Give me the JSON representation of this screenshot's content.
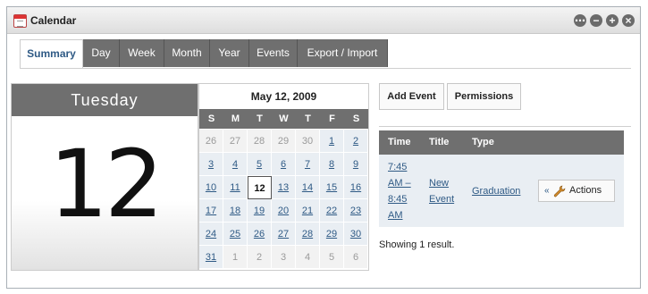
{
  "portlet": {
    "title": "Calendar",
    "icon": "calendar-icon"
  },
  "window_buttons": [
    "options-icon",
    "minimize-icon",
    "maximize-icon",
    "close-icon"
  ],
  "tabs": [
    {
      "label": "Summary",
      "active": true
    },
    {
      "label": "Day"
    },
    {
      "label": "Week"
    },
    {
      "label": "Month"
    },
    {
      "label": "Year"
    },
    {
      "label": "Events"
    },
    {
      "label": "Export / Import"
    }
  ],
  "day": {
    "name": "Tuesday",
    "number": "12"
  },
  "minical": {
    "month_label": "May 12, 2009",
    "dow": [
      "S",
      "M",
      "T",
      "W",
      "T",
      "F",
      "S"
    ],
    "weeks": [
      [
        {
          "d": "26",
          "o": true
        },
        {
          "d": "27",
          "o": true
        },
        {
          "d": "28",
          "o": true
        },
        {
          "d": "29",
          "o": true
        },
        {
          "d": "30",
          "o": true
        },
        {
          "d": "1"
        },
        {
          "d": "2"
        }
      ],
      [
        {
          "d": "3"
        },
        {
          "d": "4"
        },
        {
          "d": "5"
        },
        {
          "d": "6"
        },
        {
          "d": "7"
        },
        {
          "d": "8"
        },
        {
          "d": "9"
        }
      ],
      [
        {
          "d": "10"
        },
        {
          "d": "11"
        },
        {
          "d": "12",
          "t": true
        },
        {
          "d": "13"
        },
        {
          "d": "14"
        },
        {
          "d": "15"
        },
        {
          "d": "16"
        }
      ],
      [
        {
          "d": "17"
        },
        {
          "d": "18"
        },
        {
          "d": "19"
        },
        {
          "d": "20"
        },
        {
          "d": "21"
        },
        {
          "d": "22"
        },
        {
          "d": "23"
        }
      ],
      [
        {
          "d": "24"
        },
        {
          "d": "25"
        },
        {
          "d": "26"
        },
        {
          "d": "27"
        },
        {
          "d": "28"
        },
        {
          "d": "29"
        },
        {
          "d": "30"
        }
      ],
      [
        {
          "d": "31"
        },
        {
          "d": "1",
          "o": true
        },
        {
          "d": "2",
          "o": true
        },
        {
          "d": "3",
          "o": true
        },
        {
          "d": "4",
          "o": true
        },
        {
          "d": "5",
          "o": true
        },
        {
          "d": "6",
          "o": true
        }
      ]
    ]
  },
  "buttons": {
    "add_event": "Add Event",
    "permissions": "Permissions"
  },
  "events": {
    "columns": [
      "Time",
      "Title",
      "Type"
    ],
    "rows": [
      {
        "time_lines": [
          "7:45",
          "AM –",
          "8:45",
          "AM"
        ],
        "title_lines": [
          "New",
          "Event"
        ],
        "type": "Graduation",
        "actions": "Actions"
      }
    ],
    "footer": "Showing 1 result."
  },
  "colors": {
    "header_gray": "#6f6f6f",
    "link_blue": "#2f5a85",
    "cell_bg": "#e9eef3"
  }
}
